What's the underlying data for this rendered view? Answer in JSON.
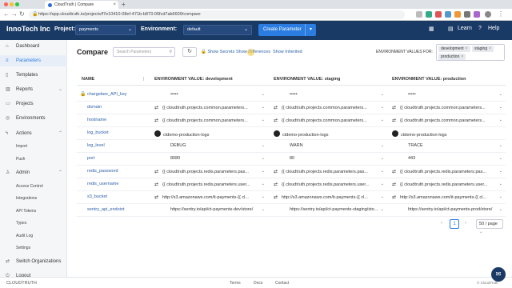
{
  "browser": {
    "tab_title": "CloudTruth | Compare",
    "url": "https://app.cloudtruth.io/projects/f7e10410-08ef-471b-b873-06fcd7ab6609/compare"
  },
  "topbar": {
    "brand": "InnoTech Inc",
    "project_label": "Project:",
    "project_value": "payments",
    "environment_label": "Environment:",
    "environment_value": "default",
    "create_button": "Create Parameter",
    "learn": "Learn",
    "help": "Help"
  },
  "sidebar": {
    "items": [
      {
        "label": "Dashboard",
        "icon": "home-icon"
      },
      {
        "label": "Parameters",
        "icon": "list-icon"
      },
      {
        "label": "Templates",
        "icon": "file-icon"
      },
      {
        "label": "Reports",
        "icon": "chart-icon"
      },
      {
        "label": "Projects",
        "icon": "folder-icon"
      },
      {
        "label": "Environments",
        "icon": "globe-icon"
      },
      {
        "label": "Actions",
        "icon": "bolt-icon"
      },
      {
        "label": "Admin",
        "icon": "user-icon"
      },
      {
        "label": "Switch Organizations",
        "icon": "switch-icon"
      },
      {
        "label": "Logout",
        "icon": "logout-icon"
      }
    ],
    "actions_sub": [
      "Import",
      "Push"
    ],
    "admin_sub": [
      "Access Control",
      "Integrations",
      "API Tokens",
      "Types",
      "Audit Log",
      "Settings"
    ]
  },
  "compare": {
    "title": "Compare",
    "search_placeholder": "Search Parameters",
    "show_secrets": "Show Secrets",
    "show_differences": "Show Differences",
    "show_inherited": "Show Inherited",
    "env_values_for": "ENVIRONMENT VALUES FOR:",
    "env_chips": [
      "development",
      "staging",
      "production"
    ]
  },
  "table": {
    "headers": [
      "NAME",
      "ENVIRONMENT VALUE: development",
      "ENVIRONMENT VALUE: staging",
      "ENVIRONMENT VALUE: production"
    ],
    "rows": [
      {
        "name": "chargebee_API_key",
        "dev": "•••••",
        "stg": "•••••",
        "prod": "•••••"
      },
      {
        "name": "domain",
        "dev": "{{ cloudtruth.projects.common.parameters...",
        "stg": "{{ cloudtruth.projects.common.parameters...",
        "prod": "{{ cloudtruth.projects.common.parameters..."
      },
      {
        "name": "hostname",
        "dev": "{{ cloudtruth.projects.common.parameters...",
        "stg": "{{ cloudtruth.projects.common.parameters...",
        "prod": "{{ cloudtruth.projects.common.parameters..."
      },
      {
        "name": "log_bucket",
        "dev": "ctdemo-production-logs",
        "stg": "ctdemo-production-logs",
        "prod": "ctdemo-production-logs"
      },
      {
        "name": "log_level",
        "dev": "DEBUG",
        "stg": "WARN",
        "prod": "TRACE"
      },
      {
        "name": "port",
        "dev": "8080",
        "stg": "80",
        "prod": "443"
      },
      {
        "name": "redis_password",
        "dev": "{{ cloudtruth.projects.redis.parameters.pas...",
        "stg": "{{ cloudtruth.projects.redis.parameters.pas...",
        "prod": "{{ cloudtruth.projects.redis.parameters.pas..."
      },
      {
        "name": "redis_username",
        "dev": "{{ cloudtruth.projects.redis.parameters.user...",
        "stg": "{{ cloudtruth.projects.redis.parameters.user...",
        "prod": "{{ cloudtruth.projects.redis.parameters.user..."
      },
      {
        "name": "s3_bucket",
        "dev": "http://s3.amazonaws.com/it-payments-{{ cl...",
        "stg": "http://s3.amazonaws.com/it-payments-{{ cl...",
        "prod": "http://s3.amazonaws.com/it-payments-{{ cl..."
      },
      {
        "name": "sentry_api_endoint",
        "dev": "https://sentry.io/api/ct-payments-dev/store/",
        "stg": "https://sentry.io/api/ct-payments-staging/sto...",
        "prod": "https://sentry.io/api/ct-payments-prod/store/"
      }
    ]
  },
  "pagination": {
    "page": "1",
    "size": "50 / page"
  },
  "footer": {
    "logo": "CLOUDTRUTH",
    "terms": "Terms",
    "docs": "Docs",
    "contact": "Contact",
    "copyright": "© CloudTruth"
  }
}
